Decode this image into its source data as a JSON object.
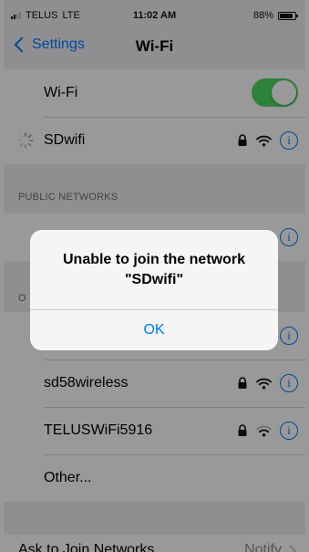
{
  "status_bar": {
    "carrier": "TELUS",
    "network": "LTE",
    "time": "11:02 AM",
    "battery": "88%",
    "battery_level": 0.88,
    "signal_bars": 2
  },
  "nav": {
    "back_label": "Settings",
    "title": "Wi-Fi"
  },
  "wifi_toggle": {
    "label": "Wi-Fi",
    "on": true
  },
  "current_network": {
    "name": "SDwifi",
    "connecting": true,
    "secured": true
  },
  "sections": {
    "public_header": "PUBLIC NETWORKS",
    "other_header_partial": "O"
  },
  "other_networks": [
    {
      "name": "sd58wireless",
      "secured": true
    },
    {
      "name": "TELUSWiFi5916",
      "secured": true
    },
    {
      "name": "Other...",
      "secured": false
    }
  ],
  "ask_to_join": {
    "label": "Ask to Join Networks",
    "value": "Notify"
  },
  "alert": {
    "title_line1": "Unable to join the network",
    "title_line2": "\"SDwifi\"",
    "ok_label": "OK"
  },
  "colors": {
    "accent": "#007aff",
    "toggle_on": "#4cd964",
    "background": "#efeff4"
  }
}
